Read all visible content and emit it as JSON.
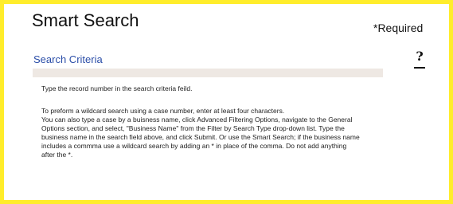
{
  "header": {
    "title": "Smart Search",
    "required_label": "*Required"
  },
  "search": {
    "section_label": "Search Criteria",
    "help_symbol": "?",
    "value": "",
    "placeholder": ""
  },
  "help_text": {
    "line1": "Type the record number in the search criteria feild.",
    "paragraph_lines": [
      "To preform a wildcard search using a case number, enter at least four characters.",
      "You can also type a case by a buisness name, click Advanced Filtering Options, navigate to the General",
      "Options section, and select, \"Business Name\" from the Filter by Search Type drop-down list. Type the",
      "business name in the search field above, and click Submit. Or use the Smart Search; if the business name",
      "includes a commma use a  wildcard search by adding an * in place of the comma. Do not add anything",
      "after the *."
    ]
  },
  "colors": {
    "frame_border": "#ffed2b",
    "section_label": "#2b4ea8",
    "input_background": "#eee8e3"
  },
  "icons": {
    "help": "question-mark-icon"
  }
}
